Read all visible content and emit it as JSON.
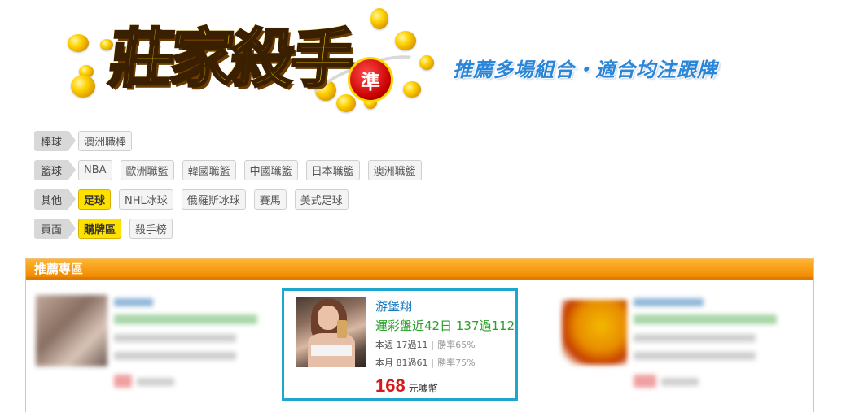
{
  "banner": {
    "logo_text": "莊家殺手",
    "logo_badge": "準",
    "slogan": "推薦多場組合・適合均注跟牌"
  },
  "filters": [
    {
      "category": "棒球",
      "options": [
        {
          "label": "澳洲職棒",
          "active": false
        }
      ]
    },
    {
      "category": "籃球",
      "options": [
        {
          "label": "NBA",
          "active": false
        },
        {
          "label": "歐洲職籃",
          "active": false
        },
        {
          "label": "韓國職籃",
          "active": false
        },
        {
          "label": "中國職籃",
          "active": false
        },
        {
          "label": "日本職籃",
          "active": false
        },
        {
          "label": "澳洲職籃",
          "active": false
        }
      ]
    },
    {
      "category": "其他",
      "options": [
        {
          "label": "足球",
          "active": true
        },
        {
          "label": "NHL冰球",
          "active": false
        },
        {
          "label": "俄羅斯冰球",
          "active": false
        },
        {
          "label": "賽馬",
          "active": false
        },
        {
          "label": "美式足球",
          "active": false
        }
      ]
    },
    {
      "category": "頁面",
      "options": [
        {
          "label": "購牌區",
          "active": true
        },
        {
          "label": "殺手榜",
          "active": false
        }
      ]
    }
  ],
  "recommend": {
    "title": "推薦專區",
    "featured": {
      "name": "游堡翔",
      "record": "運彩盤近42日 137過112",
      "week": "本週 17過11",
      "week_rate": "勝率65%",
      "month": "本月 81過61",
      "month_rate": "勝率75%",
      "price": "168",
      "price_unit": "元噱幣"
    }
  },
  "colors": {
    "accent_orange": "#f08a00",
    "active_yellow": "#ffe100",
    "highlight_border": "#1fa6cf",
    "name_blue": "#1c7ec2",
    "record_green": "#2aa12a",
    "price_red": "#d61a1a"
  }
}
